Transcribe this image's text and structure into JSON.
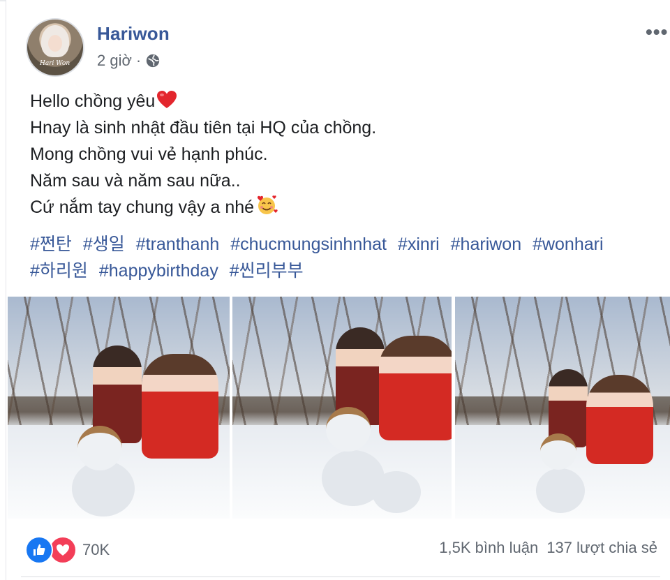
{
  "post": {
    "author": "Hariwon",
    "time": "2 giờ",
    "privacy_icon": "globe-icon",
    "more_icon": "•••",
    "avatar_signature": "Hari Won",
    "lines": [
      "Hello chồng yêu",
      "Hnay là sinh nhật đầu tiên tại HQ của chồng.",
      "Mong chồng vui vẻ hạnh phúc.",
      "Năm sau và năm sau nữa..",
      "Cứ nắm tay chung vậy a nhé"
    ],
    "hashtags": [
      "#쩐탄",
      "#생일",
      "#tranthanh",
      "#chucmungsinhnhat",
      "#xinri",
      "#hariwon",
      "#wonhari",
      "#하리원",
      "#happybirthday",
      "#씬리부부"
    ],
    "photos": [
      "photo-1",
      "photo-2",
      "photo-3"
    ]
  },
  "footer": {
    "reaction_count": "70K",
    "comments": "1,5K bình luận",
    "shares": "137 lượt chia sẻ"
  },
  "colors": {
    "link": "#385898",
    "meta": "#606770",
    "like": "#1877f2",
    "love": "#f33e58"
  }
}
